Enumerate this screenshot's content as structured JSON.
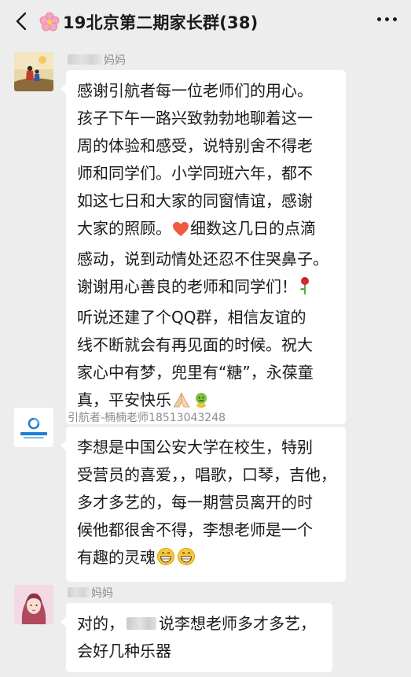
{
  "header": {
    "title": "19北京第二期家长群(38)",
    "icons": [
      "back-arrow-icon",
      "flower-icon",
      "more-icon"
    ]
  },
  "messages": [
    {
      "sender_suffix": "妈妈",
      "lines": [
        "感谢引航者每一位老师们的用心。",
        "孩子下午一路兴致勃勃地聊着这一",
        "周的体验和感受，说特别舍不得老",
        "师和同学们。小学同班六年，都不",
        "如这七日和大家的同窗情谊，感谢",
        "大家的照顾。",
        "细数这几日的点滴",
        "感动，说到动情处还忍不住哭鼻子。",
        "谢谢用心善良的老师和同学们！",
        "听说还建了个QQ群，相信友谊的",
        "线不断就会有再见面的时候。祝大",
        "家心中有梦，兜里有“糖”，永葆童",
        "真，平安快乐"
      ]
    },
    {
      "sender": "引航者-楠楠老师18513043248",
      "lines": [
        "李想是中国公安大学在校生，特别",
        "受营员的喜爱，，唱歌，口琴，吉他，",
        "多才多艺的，每一期营员离开的时",
        "候他都很舍不得，李想老师是一个",
        "有趣的灵魂"
      ]
    },
    {
      "sender_suffix": "妈妈",
      "line1_start": "对的，",
      "line1_end": "说李想老师多才多艺，",
      "line2": "会好几种乐器"
    }
  ],
  "colors": {
    "background": "#ededed",
    "bubble": "#ffffff",
    "sender_text": "#8c8c8c",
    "message_text": "#1a1a1a"
  }
}
